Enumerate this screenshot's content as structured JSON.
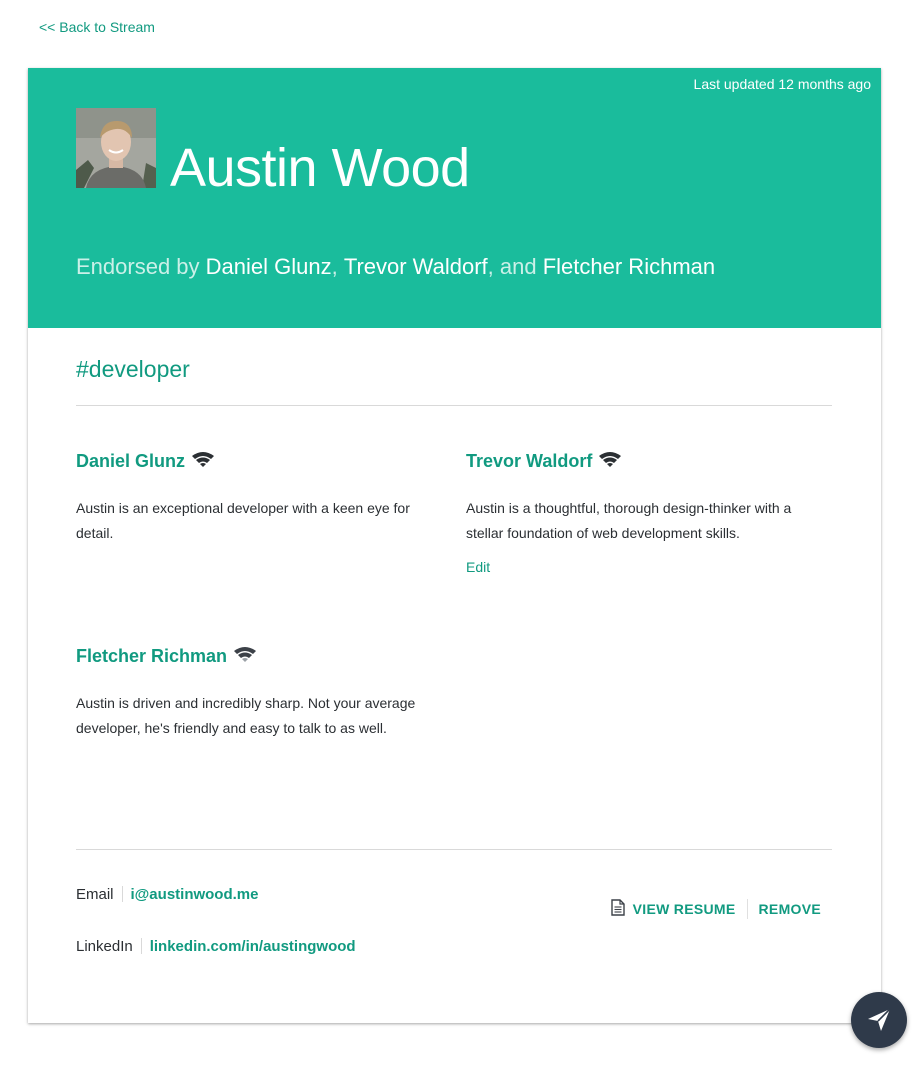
{
  "nav": {
    "back_label": "<< Back to Stream"
  },
  "profile": {
    "last_updated": "Last updated 12 months ago",
    "name": "Austin Wood",
    "endorsed_prefix": "Endorsed by ",
    "endorsers": [
      "Daniel Glunz",
      "Trevor Waldorf",
      "Fletcher Richman"
    ],
    "sep_comma": ", ",
    "sep_and": ", and "
  },
  "tag": "#developer",
  "endorsements": [
    {
      "name": "Daniel Glunz",
      "text": "Austin is an exceptional developer with a keen eye for detail.",
      "icon": "wifi-icon"
    },
    {
      "name": "Trevor Waldorf",
      "text": "Austin is a thoughtful, thorough design-thinker with a stellar foundation of web development skills.",
      "edit_label": "Edit",
      "icon": "wifi-icon"
    },
    {
      "name": "Fletcher Richman",
      "text": "Austin is driven and incredibly sharp. Not your average developer, he's friendly and easy to talk to as well.",
      "icon": "wifi-icon"
    }
  ],
  "contact": {
    "email_label": "Email",
    "email": "i@austinwood.me",
    "linkedin_label": "LinkedIn",
    "linkedin": "linkedin.com/in/austingwood"
  },
  "actions": {
    "view_resume": "VIEW RESUME",
    "remove": "REMOVE",
    "resume_icon": "document-icon"
  },
  "fab": {
    "icon": "send-icon"
  },
  "colors": {
    "accent": "#1abc9c",
    "link": "#119a80",
    "fab": "#2f3a4a"
  }
}
